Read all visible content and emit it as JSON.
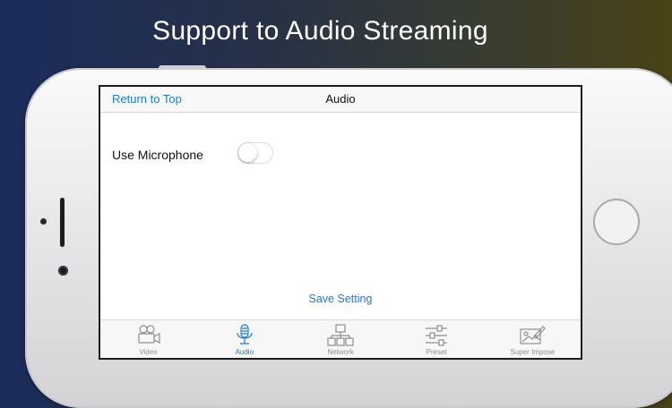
{
  "headline": "Support to Audio Streaming",
  "navbar": {
    "back_label": "Return to Top",
    "title": "Audio"
  },
  "settings": {
    "microphone_label": "Use Microphone",
    "microphone_enabled": false
  },
  "save_label": "Save Setting",
  "tabs": [
    {
      "label": "Video",
      "icon": "video-camera-icon",
      "active": false
    },
    {
      "label": "Audio",
      "icon": "microphone-icon",
      "active": true
    },
    {
      "label": "Network",
      "icon": "network-icon",
      "active": false
    },
    {
      "label": "Preset",
      "icon": "sliders-icon",
      "active": false
    },
    {
      "label": "Super Impose",
      "icon": "image-edit-icon",
      "active": false
    }
  ],
  "colors": {
    "accent": "#1a7ad6",
    "inactive": "#8e8e93"
  }
}
